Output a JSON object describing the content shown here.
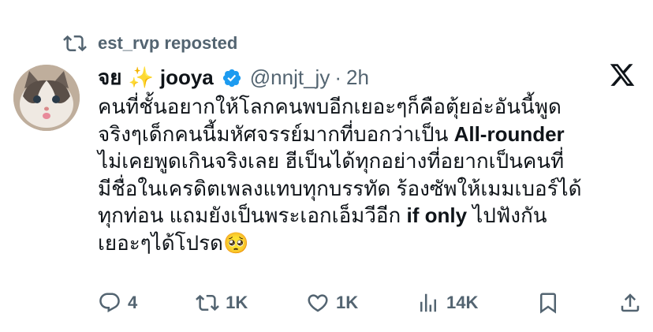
{
  "repost": {
    "label": "est_rvp reposted",
    "icon": "repost-icon"
  },
  "author": {
    "prefix": "จย",
    "emoji": "✨",
    "name": "jooya",
    "verified_icon": "verified-badge-icon",
    "handle": "@nnjt_jy",
    "separator": "·",
    "time": "2h"
  },
  "body": {
    "line1": "คนที่ชั้นอยากให้โลกคนพบอีกเยอะๆก็คือตุ้ยอ่ะอันนี้พูด",
    "line2_start": "จริงๆเด็กคนนี้มหัศจรรย์มากที่บอกว่าเป็น ",
    "line2_bold": "All-rounder",
    "line3": "ไม่เคยพูดเกินจริงเลย ฮีเป็นได้ทุกอย่างที่อยากเป็นคนที่",
    "line4": "มีชื่อในเครดิตเพลงแทบทุกบรรทัด ร้องซัพให้เมมเบอร์ได้",
    "line5_start": "ทุกท่อน แถมยังเป็นพระเอกเอ็มวีอีก ",
    "line5_bold": "if only",
    "line5_end": " ไปฟังกัน",
    "line6": "เยอะๆได้โปรด",
    "emoji": "🥺"
  },
  "actions": {
    "replies": "4",
    "reposts": "1K",
    "likes": "1K",
    "views": "14K"
  },
  "colors": {
    "secondary": "#536471",
    "verified": "#1d9bf0",
    "text": "#0f1419"
  }
}
